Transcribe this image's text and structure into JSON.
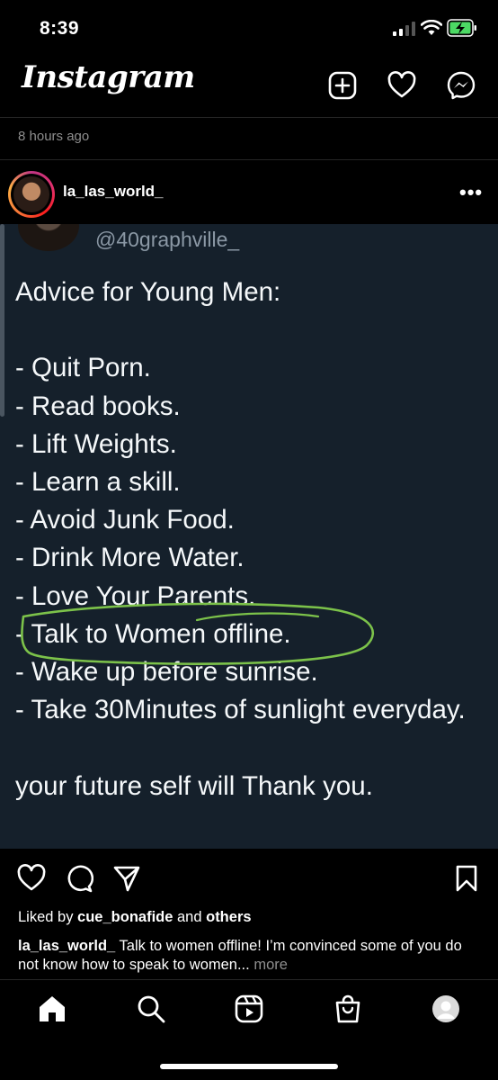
{
  "status_bar": {
    "time": "8:39"
  },
  "header": {
    "title": "Instagram",
    "icons": [
      "plus-square-icon",
      "heart-icon",
      "messenger-icon"
    ]
  },
  "post": {
    "time_ago": "8 hours ago",
    "username": "la_las_world_",
    "more_label": "•••",
    "image": {
      "handle": "@40graphville_",
      "text": "Advice for Young Men:\n\n- Quit Porn.\n- Read books.\n- Lift Weights.\n- Learn a skill.\n- Avoid Junk Food.\n- Drink More Water.\n- Love Your Parents.\n- Talk to Women offline.\n- Wake up before sunrise.\n- Take 30Minutes of sunlight everyday.\n\nyour future self will Thank you.",
      "highlight_color": "#7cc24a"
    },
    "liked_by": {
      "prefix": "Liked by ",
      "user": "cue_bonafide",
      "middle": " and ",
      "others": "others"
    },
    "caption": {
      "user": "la_las_world_",
      "text": " Talk to women offline! I’m convinced some of you do not know how to speak to women...",
      "more": " more"
    }
  },
  "bottom_nav": [
    "home-icon",
    "search-icon",
    "reels-icon",
    "shop-icon",
    "profile-avatar"
  ]
}
